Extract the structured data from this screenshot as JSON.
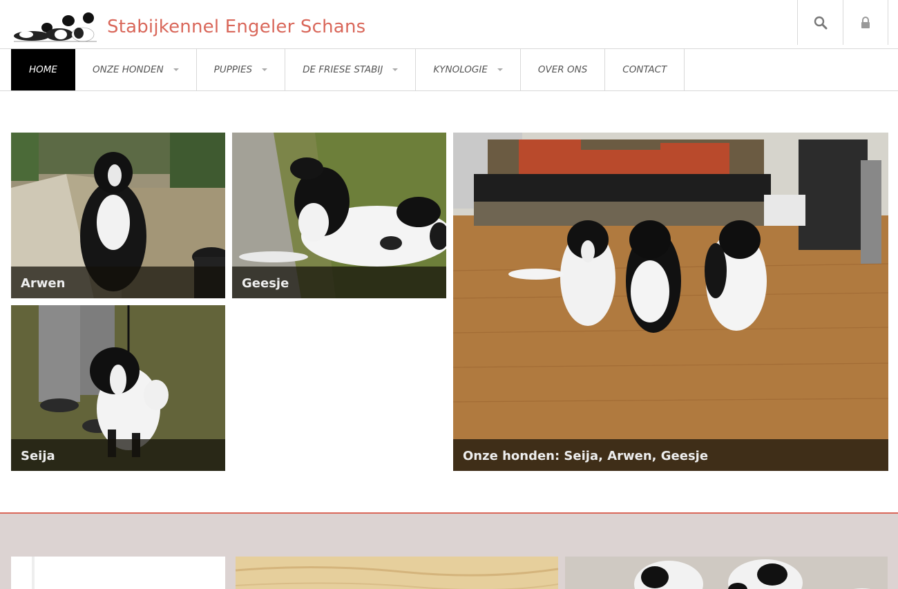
{
  "site": {
    "title": "Stabijkennel Engeler Schans"
  },
  "header": {
    "search_icon": "search-icon",
    "lock_icon": "lock-icon"
  },
  "nav": {
    "items": [
      {
        "label": "HOME",
        "active": true,
        "dropdown": false
      },
      {
        "label": "ONZE HONDEN",
        "active": false,
        "dropdown": true
      },
      {
        "label": "PUPPIES",
        "active": false,
        "dropdown": true
      },
      {
        "label": "DE FRIESE STABIJ",
        "active": false,
        "dropdown": true
      },
      {
        "label": "KYNOLOGIE",
        "active": false,
        "dropdown": true
      },
      {
        "label": "OVER ONS",
        "active": false,
        "dropdown": false
      },
      {
        "label": "CONTACT",
        "active": false,
        "dropdown": false
      }
    ]
  },
  "gallery": {
    "tiles": [
      {
        "caption": "Arwen"
      },
      {
        "caption": "Geesje"
      },
      {
        "caption": "Seija"
      },
      {
        "caption": "Onze honden: Seija, Arwen, Geesje"
      }
    ]
  },
  "colors": {
    "accent": "#d9675a",
    "nav_active_bg": "#000000",
    "band_bg": "#dcd3d2"
  }
}
